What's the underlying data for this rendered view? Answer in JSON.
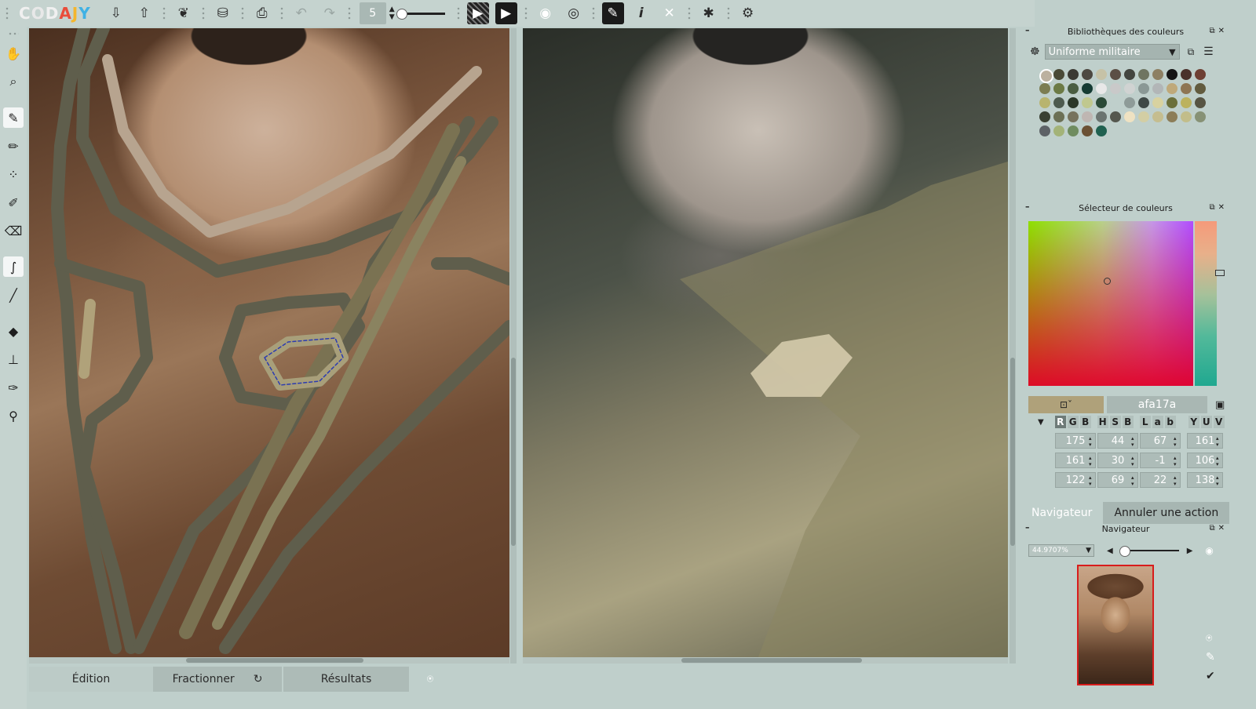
{
  "app": {
    "logo": [
      "C",
      "O",
      "D",
      "A",
      "J",
      "Y"
    ]
  },
  "toolbar": {
    "icons": [
      "import-icon",
      "export-icon",
      "hint-icon",
      "save-icon",
      "print-icon",
      "undo-icon",
      "redo-icon",
      "play-stripes-icon",
      "play-icon",
      "eye-icon",
      "eye-alt-icon",
      "pen-icon",
      "info-icon",
      "fullscreen-icon",
      "star-icon",
      "settings-icon"
    ],
    "brush_size": "5"
  },
  "tools": [
    "hand-icon",
    "zoom-icon",
    "brush-icon",
    "marker-icon",
    "spray-icon",
    "pencil-icon",
    "eraser-icon",
    "smudge-icon",
    "line-icon",
    "fill-icon",
    "stamp-icon",
    "picker-icon",
    "eyedropper-icon"
  ],
  "bottom_tabs": {
    "edition": "Édition",
    "fractionner": "Fractionner",
    "resultats": "Résultats"
  },
  "color_library": {
    "title": "Bibliothèques des couleurs",
    "selected": "Uniforme militaire",
    "swatches": [
      "#bcb19f",
      "#4a4a37",
      "#3c3a33",
      "#4d4841",
      "#c6c2a7",
      "#5b4f45",
      "#43453f",
      "#6f7561",
      "#8d8063",
      "#151515",
      "#4a302b",
      "#6e4034",
      "#7c7d51",
      "#6c7a45",
      "#4a5d41",
      "#153b33",
      "#e8e8e8",
      "#c9c9c9",
      "#d0d3d2",
      "#8a9895",
      "#b2b6b7",
      "#bfa97a",
      "#8e7553",
      "#625b3e",
      "#b8b46f",
      "#4d5a4e",
      "#2b3728",
      "#c0c88f",
      "#2b4a37",
      "#bfcfcb",
      "#8e9b98",
      "#3e4845",
      "#d8d2a0",
      "#6b6f3a",
      "#bcb25e",
      "#575443",
      "#3a4032",
      "#6c7055",
      "#76725c",
      "#bfb6b2",
      "#6b7470",
      "#55574e",
      "#efe2c2",
      "#d3cea4",
      "#c5bd8f",
      "#8c7d58",
      "#c2bd8a",
      "#879175",
      "#5d6266",
      "#a3b378",
      "#6f8c5f",
      "#6b5134",
      "#206150"
    ]
  },
  "color_selector": {
    "title": "Sélecteur de couleurs",
    "hex": "afa17a",
    "current_color": "#afa17a",
    "modes": {
      "rgb": [
        "R",
        "G",
        "B"
      ],
      "hsb": [
        "H",
        "S",
        "B"
      ],
      "lab": [
        "L",
        "a",
        "b"
      ],
      "yuv": [
        "Y",
        "U",
        "V"
      ]
    },
    "values": [
      [
        "175",
        "44",
        "67",
        "161"
      ],
      [
        "161",
        "30",
        "-1",
        "106"
      ],
      [
        "122",
        "69",
        "22",
        "138"
      ]
    ]
  },
  "navigator": {
    "tab_navigator": "Navigateur",
    "tab_undo": "Annuler une action",
    "title": "Navigateur",
    "zoom": "44.9707%"
  }
}
